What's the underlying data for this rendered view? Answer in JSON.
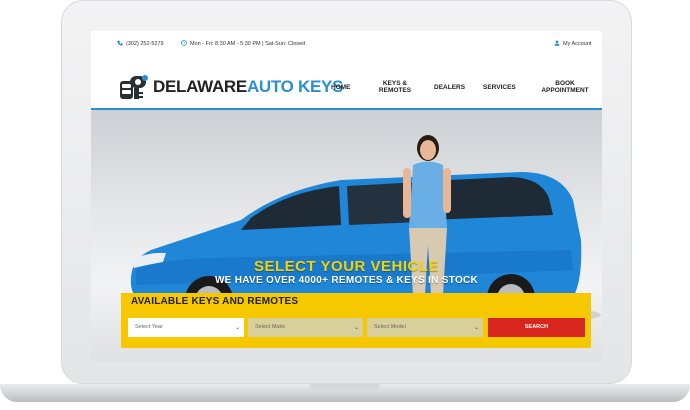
{
  "topbar": {
    "phone": "(302) 252-5279",
    "hours": "Mon - Fri: 8:30 AM - 5:30 PM | Sat-Sun: Closed",
    "account": "My Account"
  },
  "logo": {
    "word1": "DELAWARE",
    "word2": "AUTO KEYS"
  },
  "nav": [
    {
      "line1": "HOME",
      "line2": ""
    },
    {
      "line1": "KEYS &",
      "line2": "REMOTES"
    },
    {
      "line1": "DEALERS",
      "line2": ""
    },
    {
      "line1": "SERVICES",
      "line2": ""
    },
    {
      "line1": "BOOK",
      "line2": "APPOINTMENT"
    }
  ],
  "hero": {
    "headline": "SELECT YOUR VEHICLE",
    "subheadline": "WE HAVE OVER 4000+ REMOTES & KEYS IN STOCK"
  },
  "search_panel": {
    "title": "AVAILABLE KEYS AND REMOTES",
    "year_placeholder": "Select Year",
    "make_placeholder": "Select Make",
    "model_placeholder": "Select Model",
    "button": "SEARCH"
  },
  "colors": {
    "accent_blue": "#2a8ed6",
    "panel_yellow": "#f5c800",
    "search_red": "#d7261e",
    "headline_yellow": "#f5d300"
  },
  "icons": [
    "phone-icon",
    "clock-icon",
    "user-icon",
    "chevron-down-icon"
  ]
}
